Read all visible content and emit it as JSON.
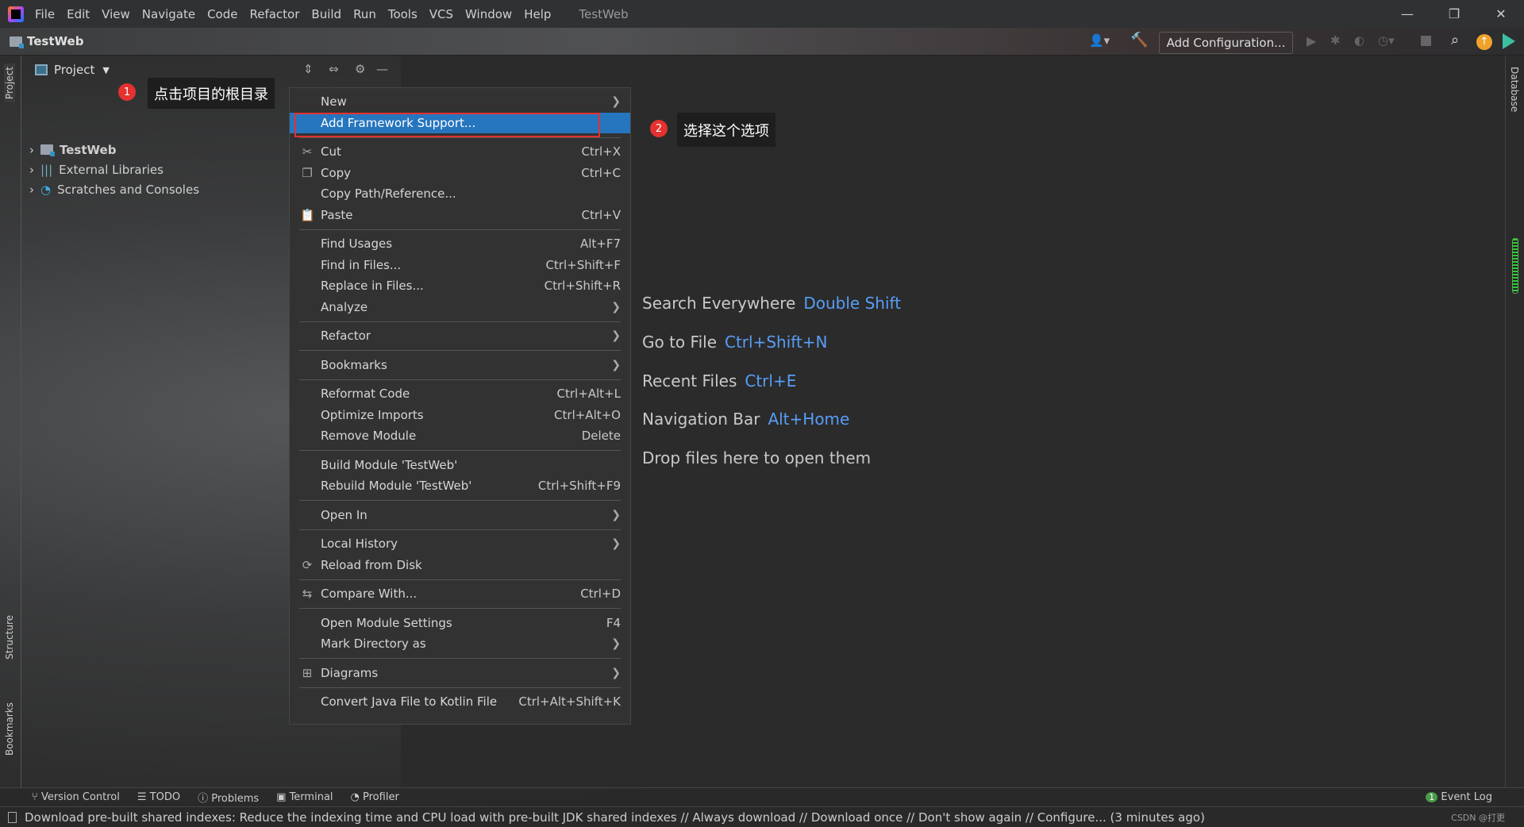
{
  "window": {
    "title": "TestWeb",
    "menu": [
      "File",
      "Edit",
      "View",
      "Navigate",
      "Code",
      "Refactor",
      "Build",
      "Run",
      "Tools",
      "VCS",
      "Window",
      "Help"
    ]
  },
  "navbar": {
    "project": "TestWeb",
    "run_config": "Add Configuration..."
  },
  "project_panel": {
    "title": "Project",
    "tree": [
      {
        "label": "TestWeb",
        "icon": "module-folder-icon"
      },
      {
        "label": "External Libraries",
        "icon": "libraries-icon"
      },
      {
        "label": "Scratches and Consoles",
        "icon": "scratches-icon"
      }
    ]
  },
  "side_tabs": {
    "left": [
      "Project",
      "Structure",
      "Bookmarks"
    ],
    "right": [
      "Database"
    ]
  },
  "annotations": {
    "step1_num": "1",
    "step1_text": "点击项目的根目录",
    "step2_num": "2",
    "step2_text": "选择这个选项",
    "color": "#e5312f"
  },
  "context_menu": [
    {
      "label": "New",
      "submenu": true
    },
    {
      "label": "Add Framework Support...",
      "selected": true
    },
    {
      "sep": true
    },
    {
      "label": "Cut",
      "shortcut": "Ctrl+X",
      "icon": "scissors-icon"
    },
    {
      "label": "Copy",
      "shortcut": "Ctrl+C",
      "icon": "copy-icon"
    },
    {
      "label": "Copy Path/Reference..."
    },
    {
      "label": "Paste",
      "shortcut": "Ctrl+V",
      "icon": "clipboard-icon"
    },
    {
      "sep": true
    },
    {
      "label": "Find Usages",
      "shortcut": "Alt+F7"
    },
    {
      "label": "Find in Files...",
      "shortcut": "Ctrl+Shift+F"
    },
    {
      "label": "Replace in Files...",
      "shortcut": "Ctrl+Shift+R"
    },
    {
      "label": "Analyze",
      "submenu": true
    },
    {
      "sep": true
    },
    {
      "label": "Refactor",
      "submenu": true
    },
    {
      "sep": true
    },
    {
      "label": "Bookmarks",
      "submenu": true
    },
    {
      "sep": true
    },
    {
      "label": "Reformat Code",
      "shortcut": "Ctrl+Alt+L"
    },
    {
      "label": "Optimize Imports",
      "shortcut": "Ctrl+Alt+O"
    },
    {
      "label": "Remove Module",
      "shortcut": "Delete"
    },
    {
      "sep": true
    },
    {
      "label": "Build Module 'TestWeb'"
    },
    {
      "label": "Rebuild Module 'TestWeb'",
      "shortcut": "Ctrl+Shift+F9"
    },
    {
      "sep": true
    },
    {
      "label": "Open In",
      "submenu": true
    },
    {
      "sep": true
    },
    {
      "label": "Local History",
      "submenu": true
    },
    {
      "label": "Reload from Disk",
      "icon": "reload-icon"
    },
    {
      "sep": true
    },
    {
      "label": "Compare With...",
      "shortcut": "Ctrl+D",
      "icon": "compare-icon"
    },
    {
      "sep": true
    },
    {
      "label": "Open Module Settings",
      "shortcut": "F4"
    },
    {
      "label": "Mark Directory as",
      "submenu": true
    },
    {
      "sep": true
    },
    {
      "label": "Diagrams",
      "submenu": true,
      "icon": "diagram-icon"
    },
    {
      "sep": true
    },
    {
      "label": "Convert Java File to Kotlin File",
      "shortcut": "Ctrl+Alt+Shift+K"
    }
  ],
  "editor_tips": [
    {
      "label": "Search Everywhere",
      "key": "Double Shift"
    },
    {
      "label": "Go to File",
      "key": "Ctrl+Shift+N"
    },
    {
      "label": "Recent Files",
      "key": "Ctrl+E"
    },
    {
      "label": "Navigation Bar",
      "key": "Alt+Home"
    },
    {
      "label": "Drop files here to open them",
      "key": ""
    }
  ],
  "bottom_tools": [
    "Version Control",
    "TODO",
    "Problems",
    "Terminal",
    "Profiler"
  ],
  "event_log": {
    "count": "1",
    "label": "Event Log"
  },
  "status": {
    "message": "Download pre-built shared indexes: Reduce the indexing time and CPU load with pre-built JDK shared indexes // Always download // Download once // Don't show again // Configure... (3 minutes ago)",
    "watermark": "CSDN @打更"
  },
  "colors": {
    "accent": "#2675bf",
    "link": "#589df6",
    "menu_bg": "#323232"
  }
}
